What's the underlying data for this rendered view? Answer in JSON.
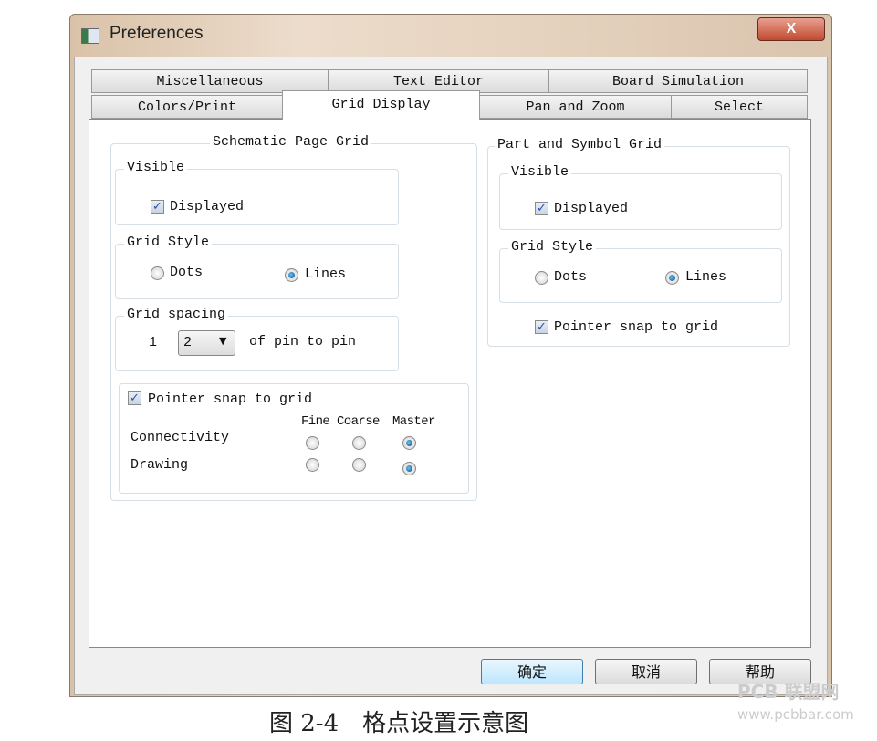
{
  "window": {
    "title": "Preferences",
    "close_label": "X"
  },
  "tabs": {
    "row1": [
      "Miscellaneous",
      "Text Editor",
      "Board Simulation"
    ],
    "row2": [
      "Colors/Print",
      "Grid Display",
      "Pan and Zoom",
      "Select"
    ],
    "active": "Grid Display"
  },
  "schematic": {
    "title": "Schematic Page Grid",
    "visible_label": "Visible",
    "displayed_label": "Displayed",
    "displayed": true,
    "style_label": "Grid Style",
    "dots_label": "Dots",
    "lines_label": "Lines",
    "style": "Lines",
    "spacing_label": "Grid spacing",
    "spacing_prefix": "1",
    "spacing_value": "2",
    "spacing_suffix": "of pin to pin",
    "snap_label": "Pointer snap to grid",
    "snap": true,
    "cols": [
      "Fine",
      "Coarse",
      "Master"
    ],
    "rows": [
      {
        "label": "Connectivity",
        "selected": "Master"
      },
      {
        "label": "Drawing",
        "selected": "Master"
      }
    ]
  },
  "part": {
    "title": "Part and Symbol Grid",
    "visible_label": "Visible",
    "displayed_label": "Displayed",
    "displayed": true,
    "style_label": "Grid Style",
    "dots_label": "Dots",
    "lines_label": "Lines",
    "style": "Lines",
    "snap_label": "Pointer snap to grid",
    "snap": true
  },
  "buttons": {
    "ok": "确定",
    "cancel": "取消",
    "help": "帮助"
  },
  "caption": "图 2-4　格点设置示意图",
  "watermark": {
    "logo": "PCB 联盟网",
    "url": "www.pcbbar.com"
  }
}
